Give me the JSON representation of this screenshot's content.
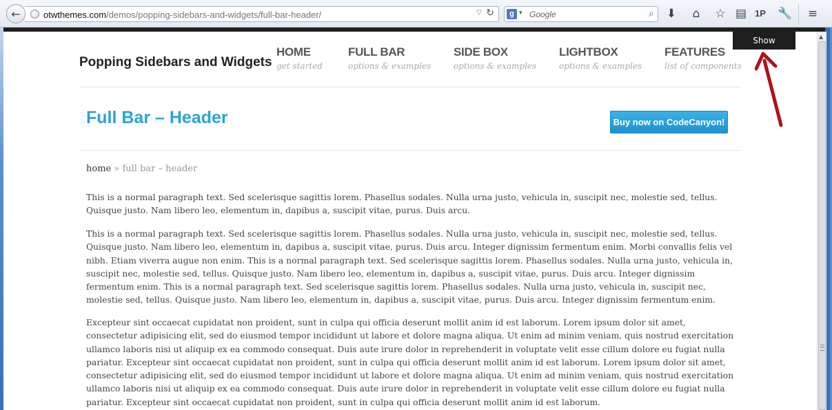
{
  "browser": {
    "url_host": "otwthemes.com",
    "url_path": "/demos/popping-sidebars-and-widgets/full-bar-header/",
    "search_placeholder": "Google",
    "search_engine_letter": "g",
    "password_manager_label": "1P"
  },
  "bar": {
    "show_label": "Show"
  },
  "site": {
    "title": "Popping Sidebars and Widgets",
    "nav": [
      {
        "label": "HOME",
        "sub": "get started"
      },
      {
        "label": "FULL BAR",
        "sub": "options & examples"
      },
      {
        "label": "SIDE BOX",
        "sub": "options & examples"
      },
      {
        "label": "LIGHTBOX",
        "sub": "options & examples"
      },
      {
        "label": "FEATURES",
        "sub": "list of components"
      }
    ]
  },
  "page": {
    "title": "Full Bar – Header",
    "buy_label": "Buy now on CodeCanyon!",
    "breadcrumb_home": "home",
    "breadcrumb_sep": " » ",
    "breadcrumb_current": "full bar – header",
    "paragraphs": [
      "This is a normal paragraph text. Sed scelerisque sagittis lorem. Phasellus sodales. Nulla urna justo, vehicula in, suscipit nec, molestie sed, tellus. Quisque justo. Nam libero leo, elementum in, dapibus a, suscipit vitae, purus. Duis arcu.",
      "This is a normal paragraph text. Sed scelerisque sagittis lorem. Phasellus sodales. Nulla urna justo, vehicula in, suscipit nec, molestie sed, tellus. Quisque justo. Nam libero leo, elementum in, dapibus a, suscipit vitae, purus. Duis arcu. Integer dignissim fermentum enim. Morbi convallis felis vel nibh. Etiam viverra augue non enim. This is a normal paragraph text. Sed scelerisque sagittis lorem. Phasellus sodales. Nulla urna justo, vehicula in, suscipit nec, molestie sed, tellus. Quisque justo. Nam libero leo, elementum in, dapibus a, suscipit vitae, purus. Duis arcu. Integer dignissim fermentum enim. This is a normal paragraph text. Sed scelerisque sagittis lorem. Phasellus sodales. Nulla urna justo, vehicula in, suscipit nec, molestie sed, tellus. Quisque justo. Nam libero leo, elementum in, dapibus a, suscipit vitae, purus. Duis arcu. Integer dignissim fermentum enim.",
      "Excepteur sint occaecat cupidatat non proident, sunt in culpa qui officia deserunt mollit anim id est laborum. Lorem ipsum dolor sit amet, consectetur adipisicing elit, sed do eiusmod tempor incididunt ut labore et dolore magna aliqua. Ut enim ad minim veniam, quis nostrud exercitation ullamco laboris nisi ut aliquip ex ea commodo consequat. Duis aute irure dolor in reprehenderit in voluptate velit esse cillum dolore eu fugiat nulla pariatur. Excepteur sint occaecat cupidatat non proident, sunt in culpa qui officia deserunt mollit anim id est laborum. Lorem ipsum dolor sit amet, consectetur adipisicing elit, sed do eiusmod tempor incididunt ut labore et dolore magna aliqua. Ut enim ad minim veniam, quis nostrud exercitation ullamco laboris nisi ut aliquip ex ea commodo consequat. Duis aute irure dolor in reprehenderit in voluptate velit esse cillum dolore eu fugiat nulla pariatur. Excepteur sint occaecat cupidatat non proident, sunt in culpa qui officia deserunt mollit anim id est laborum."
    ]
  },
  "colors": {
    "accent": "#2aa3d8",
    "bar": "#1e1e1e",
    "arrow": "#b0101a"
  },
  "icons": [
    "back-arrow-icon",
    "globe-icon",
    "dropdown-icon",
    "reload-icon",
    "google-icon",
    "search-icon",
    "download-icon",
    "home-icon",
    "bookmark-star-icon",
    "reading-list-icon",
    "password-manager-icon",
    "wrench-icon",
    "menu-icon"
  ]
}
